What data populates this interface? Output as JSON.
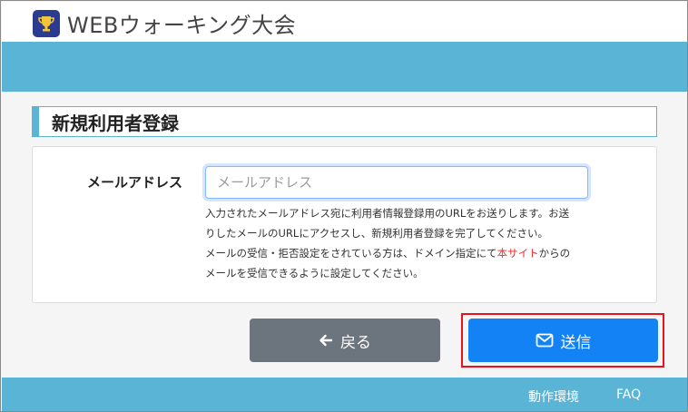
{
  "header": {
    "title": "WEBウォーキング大会",
    "logo_icon": "trophy-icon"
  },
  "section": {
    "title": "新規利用者登録"
  },
  "form": {
    "email_label": "メールアドレス",
    "email_placeholder": "メールアドレス",
    "email_value": "",
    "help_line1": "入力されたメールアドレス宛に利用者情報登録用のURLをお送りします。お送りしたメールのURLにアクセスし、新規利用者登録を完了してください。",
    "help_line2_prefix": "メールの受信・拒否設定をされている方は、ドメイン指定にて",
    "help_line2_link": "本サイト",
    "help_line2_suffix": "からのメールを受信できるように設定してください。"
  },
  "actions": {
    "back_label": "戻る",
    "back_icon": "arrow-left-icon",
    "send_label": "送信",
    "send_icon": "envelope-icon"
  },
  "footer": {
    "environment_label": "動作環境",
    "faq_label": "FAQ"
  },
  "colors": {
    "band": "#5ab4d6",
    "primary": "#1282f4",
    "secondary": "#6c757d",
    "highlight": "#e8141c",
    "link_red": "#e0312f"
  }
}
